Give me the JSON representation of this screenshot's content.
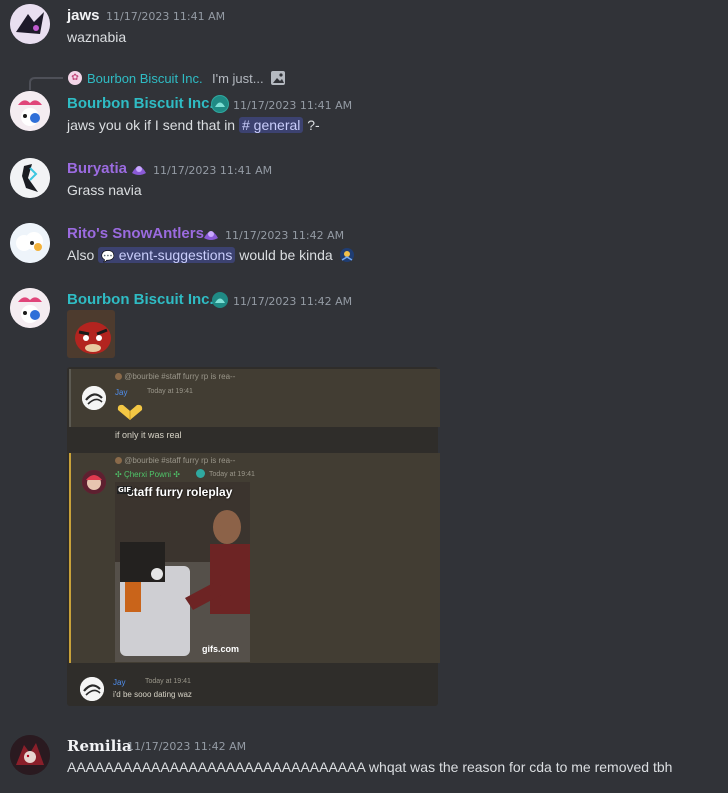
{
  "colors": {
    "background": "#313338",
    "username_white": "#f2f3f5",
    "username_teal": "#2fbcc4",
    "username_purple": "#9b6be0",
    "timestamp": "#949ba4",
    "message_text": "#dbdee1",
    "embed_bg": "#423d33"
  },
  "messages": [
    {
      "id": "m1",
      "username": "jaws",
      "timestamp": "11/17/2023 11:41 AM",
      "text": "waznabia"
    },
    {
      "id": "m2",
      "reply": {
        "author": "Bourbon Biscuit Inc.",
        "preview": "I'm just...",
        "icon": "image-icon"
      },
      "username": "Bourbon Biscuit Inc.",
      "timestamp": "11/17/2023 11:41 AM",
      "text_before": "jaws you ok if I send that in",
      "channel": "general",
      "text_after": "?-"
    },
    {
      "id": "m3",
      "username": "Buryatia",
      "timestamp": "11/17/2023 11:41 AM",
      "text": "Grass navia"
    },
    {
      "id": "m4",
      "username": "Rito's SnowAntlers",
      "timestamp": "11/17/2023 11:42 AM",
      "text_before": "Also",
      "channel": "event-suggestions",
      "text_after": "would be kinda"
    },
    {
      "id": "m5",
      "username": "Bourbon Biscuit Inc.",
      "timestamp": "11/17/2023 11:42 AM",
      "screenshot": {
        "block1": {
          "reply_line": "@bourbie #staff furry rp is rea--",
          "author": "Jay",
          "time": "Today at 19:41",
          "text": "if only it was real"
        },
        "block2": {
          "reply_line": "@bourbie #staff furry rp is rea--",
          "author": "Çherxi Powni",
          "time": "Today at 19:41",
          "gif_caption": "staff furry roleplay",
          "gif_badge": "GIF",
          "gif_source": "gifs.com"
        },
        "block3": {
          "author": "Jay",
          "time": "Today at 19:41",
          "text": "i'd be sooo dating waz"
        }
      }
    },
    {
      "id": "m6",
      "username": "Remilia",
      "timestamp": "11/17/2023 11:42 AM",
      "text": "AAAAAAAAAAAAAAAAAAAAAAAAAAAAAAAA whqat was the reason for cda to me removed tbh"
    }
  ]
}
